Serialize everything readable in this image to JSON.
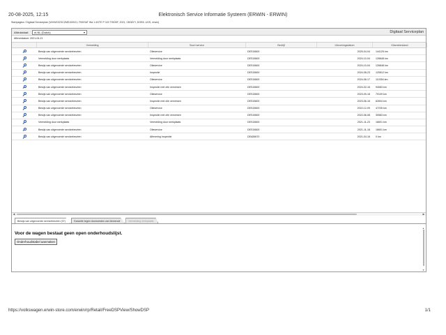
{
  "print_header": {
    "datetime": "20-08-2025, 12:15",
    "title": "Elektronisch Service Informatie Systeem (ERWIN - ERWIN)"
  },
  "breadcrumb": "Startpagina / Digitaal Serviceplan (WVWZZZ3CZME100021, PASSAT Wa 1.4GTE P 115 TSID5F, 2021, CB36YY, DGE8, UGS, erwin)",
  "toolbar": {
    "language_label": "Afdrukstaal:",
    "language_value": "nl-NL (Dutch)",
    "panel_title": "Digitaal Serviceplan"
  },
  "delivery_date": "Afleverdatum: 2021-04-21",
  "table": {
    "headers": [
      "Vermelding",
      "Soort service",
      "Bedrijf",
      "Uitvoeringsdatum",
      "Kilometerstand"
    ],
    "rows": [
      {
        "desc": "Bewijs van uitgevoerde servicebeurten",
        "type": "Olieservice",
        "company": "DES15600",
        "date": "2025-04-04",
        "km": "144125 km"
      },
      {
        "desc": "Vermelding door werkplaats",
        "type": "Vermelding door werkplaats",
        "company": "DES15600",
        "date": "2024-10-04",
        "km": "126848 km"
      },
      {
        "desc": "Bewijs van uitgevoerde servicebeurten",
        "type": "Olieservice",
        "company": "DES15600",
        "date": "2024-10-04",
        "km": "126848 km"
      },
      {
        "desc": "Bewijs van uitgevoerde servicebeurten",
        "type": "Inspectie",
        "company": "DES15600",
        "date": "2024-08-23",
        "km": "120812 km"
      },
      {
        "desc": "Bewijs van uitgevoerde servicebeurten",
        "type": "Olieservice",
        "company": "DES15600",
        "date": "2024-06-17",
        "km": "110354 km"
      },
      {
        "desc": "Bewijs van uitgevoerde servicebeurten",
        "type": "Inspectie met olie verversen",
        "company": "DES15600",
        "date": "2024-02-16",
        "km": "94083 km"
      },
      {
        "desc": "Bewijs van uitgevoerde servicebeurten",
        "type": "Olieservice",
        "company": "DES15600",
        "date": "2023-09-18",
        "km": "79109 km"
      },
      {
        "desc": "Bewijs van uitgevoerde servicebeurten",
        "type": "Inspectie met olie verversen",
        "company": "DES15600",
        "date": "2023-06-16",
        "km": "62604 km"
      },
      {
        "desc": "Bewijs van uitgevoerde servicebeurten",
        "type": "Olieservice",
        "company": "DES15600",
        "date": "2022-12-09",
        "km": "47235 km"
      },
      {
        "desc": "Bewijs van uitgevoerde servicebeurten",
        "type": "Inspectie met olie verversen",
        "company": "DES15600",
        "date": "2022-06-08",
        "km": "30583 km"
      },
      {
        "desc": "Vermelding door werkplaats",
        "type": "Vermelding door werkplaats",
        "company": "DES15600",
        "date": "2021-11-23",
        "km": "16601 km"
      },
      {
        "desc": "Bewijs van uitgevoerde servicebeurten",
        "type": "Olieservice",
        "company": "DES15600",
        "date": "2021-11-18",
        "km": "16601 km"
      },
      {
        "desc": "Bewijs van uitgevoerde servicebeurten",
        "type": "Aflevering Inspectie",
        "company": "DEA55670",
        "date": "2021-04-16",
        "km": "0 km"
      }
    ]
  },
  "tabs": [
    {
      "label": "Bewijs van uitgevoerde servicebeurten (07)",
      "state": "active"
    },
    {
      "label": "Garantie tegen doorroesten van binnenuit",
      "state": "normal"
    },
    {
      "label": "Vermelding werkplaats",
      "state": "disabled"
    }
  ],
  "lower": {
    "message": "Voor de wagen bestaat geen open onderhoudslijst.",
    "button_label": "Onderhoudstabel aanmaken"
  },
  "print_footer": {
    "url": "https://volkswagen.erwin-store.com/erwin/rp/Retail/FreeDSPView/ShowDSP",
    "page": "1/1"
  },
  "icons": {
    "row_action": "magnifier-icon"
  }
}
